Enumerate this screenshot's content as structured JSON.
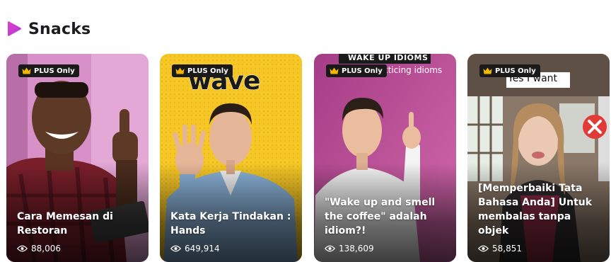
{
  "section": {
    "title": "Snacks",
    "accent": "#c73fd6"
  },
  "badge_label": "PLUS Only",
  "cards": [
    {
      "title": "Cara Memesan di Restoran",
      "views": "88,006",
      "bg": "#d58fc6"
    },
    {
      "title": "Kata Kerja Tindakan : Hands",
      "views": "649,914",
      "bg": "#f2c322",
      "overlay": "wave"
    },
    {
      "title": "\"Wake up and smell the coffee\" adalah idiom?!",
      "views": "138,609",
      "bg": "#c2559a",
      "overlay_top": "WAKE UP IDIOMS",
      "overlay_sub": "cticing idioms"
    },
    {
      "title": "[Memperbaiki Tata Bahasa Anda] Untuk membalas tanpa objek",
      "views": "58,851",
      "bg": "#7b6a5c",
      "overlay": "Yes I want"
    }
  ],
  "icons": {
    "section": "play-triangle-icon",
    "badge": "crown-icon",
    "views": "eye-icon",
    "wrong": "x-circle-icon"
  }
}
